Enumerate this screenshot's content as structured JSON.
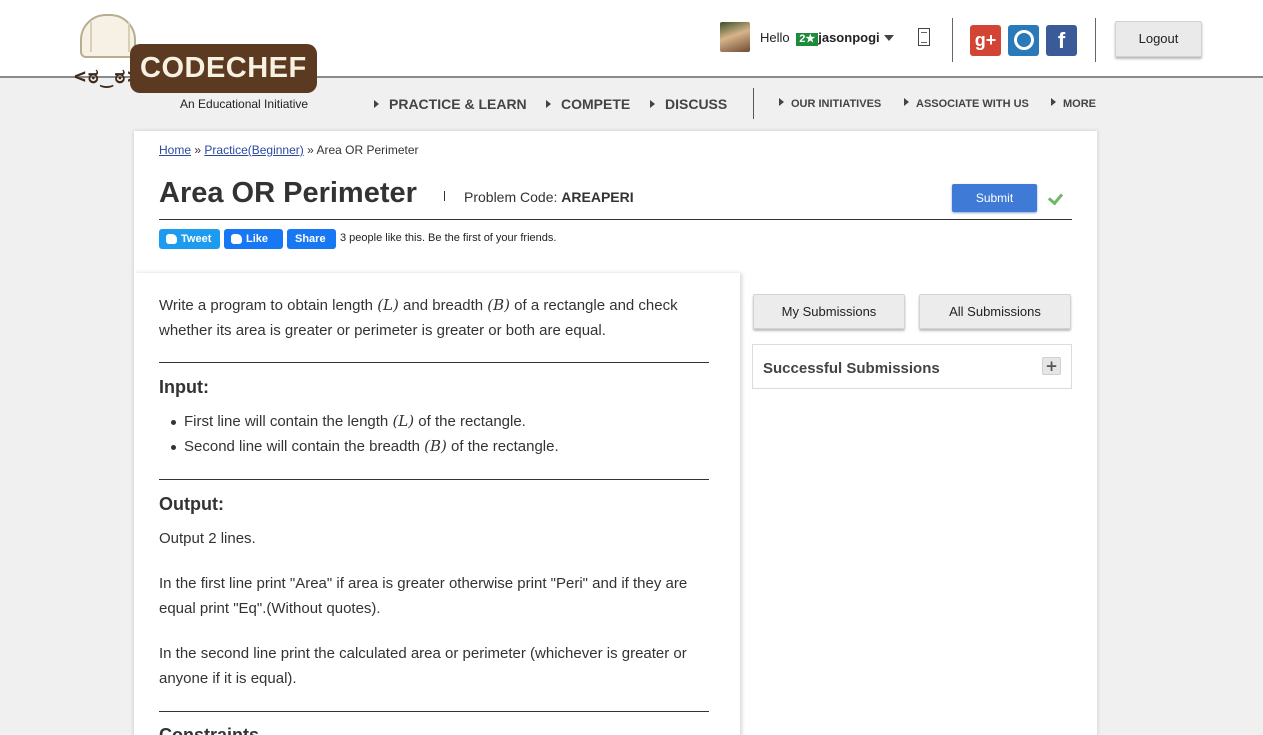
{
  "header": {
    "logo_brand": "CODECHEF",
    "logo_tagline": "An Educational Initiative",
    "greeting": "Hello",
    "user_badge": "2★",
    "username": "jasonpogi",
    "logout_label": "Logout",
    "social": {
      "gplus": "g+",
      "facebook": "f"
    }
  },
  "nav": {
    "primary": [
      "PRACTICE & LEARN",
      "COMPETE",
      "DISCUSS"
    ],
    "secondary": [
      "OUR INITIATIVES",
      "ASSOCIATE WITH US",
      "MORE"
    ]
  },
  "breadcrumb": {
    "home": "Home",
    "sep": "»",
    "practice": "Practice(Beginner)",
    "current": "Area OR Perimeter"
  },
  "problem": {
    "title": "Area OR Perimeter",
    "code_label": "Problem Code:",
    "code": "AREAPERI",
    "submit_label": "Submit",
    "share": {
      "tweet": "Tweet",
      "like": "Like",
      "share": "Share",
      "like_text": "3 people like this. Be the first of your friends."
    },
    "intro_1": "Write a program to obtain length ",
    "intro_L": "(L)",
    "intro_2": " and breadth ",
    "intro_B": "(B)",
    "intro_3": " of a rectangle and check whether its area is greater or perimeter is greater or both are equal.",
    "input_heading": "Input:",
    "input_items": [
      {
        "pre": "First line will contain the length ",
        "var": "(L)",
        "post": " of the rectangle."
      },
      {
        "pre": "Second line will contain the breadth ",
        "var": "(B)",
        "post": " of the rectangle."
      }
    ],
    "output_heading": "Output:",
    "output_p1": "Output 2 lines.",
    "output_p2": "In the first line print \"Area\" if area is greater otherwise print \"Peri\" and if they are equal print \"Eq\".(Without quotes).",
    "output_p3": "In the second line print the calculated area or perimeter (whichever is greater or anyone if it is equal).",
    "constraints_heading": "Constraints"
  },
  "sidebar": {
    "my_submissions": "My Submissions",
    "all_submissions": "All Submissions",
    "successful_submissions": "Successful Submissions",
    "expand_symbol": "+"
  }
}
